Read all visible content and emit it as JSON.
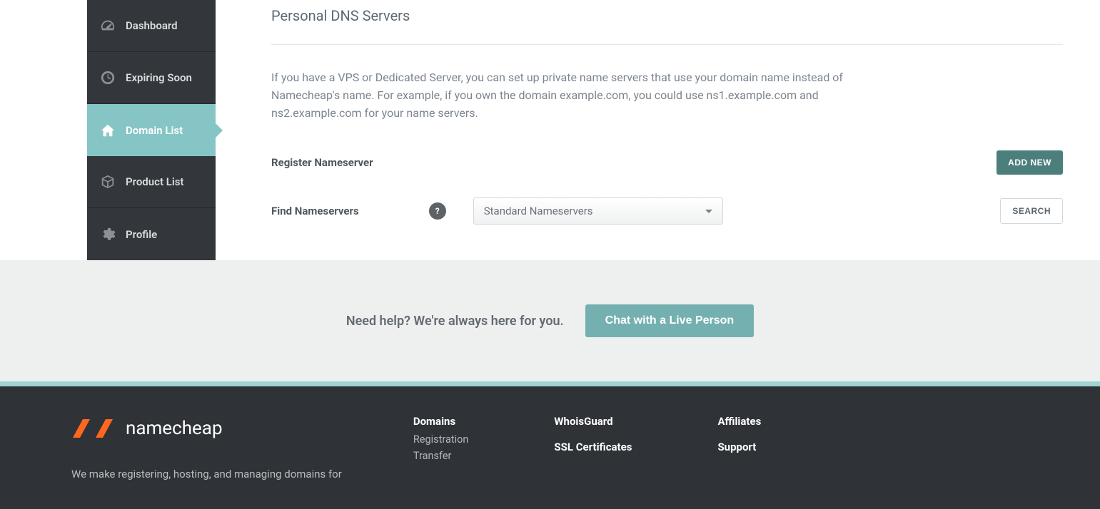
{
  "sidebar": {
    "items": [
      {
        "label": "Dashboard"
      },
      {
        "label": "Expiring Soon"
      },
      {
        "label": "Domain List"
      },
      {
        "label": "Product List"
      },
      {
        "label": "Profile"
      }
    ]
  },
  "main": {
    "title": "Personal DNS Servers",
    "description": "If you have a VPS or Dedicated Server, you can set up private name servers that use your domain name instead of Namecheap's name. For example, if you own the domain example.com, you could use ns1.example.com and ns2.example.com for your name servers.",
    "register_label": "Register Nameserver",
    "add_new_label": "ADD NEW",
    "find_label": "Find Nameservers",
    "help_mark": "?",
    "dropdown_value": "Standard Nameservers",
    "search_label": "SEARCH"
  },
  "helpbar": {
    "text": "Need help? We're always here for you.",
    "chat_label": "Chat with a Live Person"
  },
  "footer": {
    "brand": "namecheap",
    "tagline": "We make registering, hosting, and managing domains for",
    "col1": {
      "heading": "Domains",
      "links": [
        "Registration",
        "Transfer"
      ]
    },
    "col2": {
      "heading1": "WhoisGuard",
      "heading2": "SSL Certificates"
    },
    "col3": {
      "heading1": "Affiliates",
      "heading2": "Support"
    }
  }
}
